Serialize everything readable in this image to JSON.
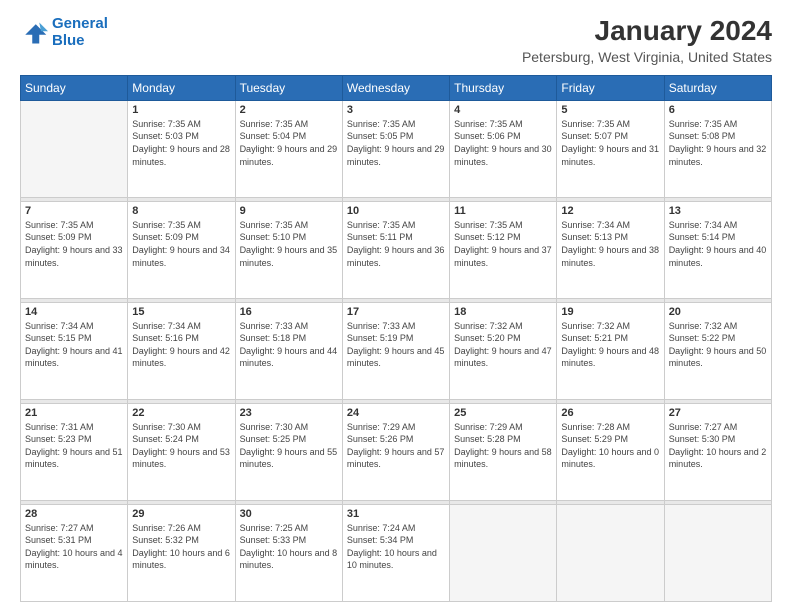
{
  "logo": {
    "line1": "General",
    "line2": "Blue"
  },
  "title": "January 2024",
  "subtitle": "Petersburg, West Virginia, United States",
  "weekdays": [
    "Sunday",
    "Monday",
    "Tuesday",
    "Wednesday",
    "Thursday",
    "Friday",
    "Saturday"
  ],
  "weeks": [
    [
      {
        "day": "",
        "sunrise": "",
        "sunset": "",
        "daylight": ""
      },
      {
        "day": "1",
        "sunrise": "Sunrise: 7:35 AM",
        "sunset": "Sunset: 5:03 PM",
        "daylight": "Daylight: 9 hours and 28 minutes."
      },
      {
        "day": "2",
        "sunrise": "Sunrise: 7:35 AM",
        "sunset": "Sunset: 5:04 PM",
        "daylight": "Daylight: 9 hours and 29 minutes."
      },
      {
        "day": "3",
        "sunrise": "Sunrise: 7:35 AM",
        "sunset": "Sunset: 5:05 PM",
        "daylight": "Daylight: 9 hours and 29 minutes."
      },
      {
        "day": "4",
        "sunrise": "Sunrise: 7:35 AM",
        "sunset": "Sunset: 5:06 PM",
        "daylight": "Daylight: 9 hours and 30 minutes."
      },
      {
        "day": "5",
        "sunrise": "Sunrise: 7:35 AM",
        "sunset": "Sunset: 5:07 PM",
        "daylight": "Daylight: 9 hours and 31 minutes."
      },
      {
        "day": "6",
        "sunrise": "Sunrise: 7:35 AM",
        "sunset": "Sunset: 5:08 PM",
        "daylight": "Daylight: 9 hours and 32 minutes."
      }
    ],
    [
      {
        "day": "7",
        "sunrise": "Sunrise: 7:35 AM",
        "sunset": "Sunset: 5:09 PM",
        "daylight": "Daylight: 9 hours and 33 minutes."
      },
      {
        "day": "8",
        "sunrise": "Sunrise: 7:35 AM",
        "sunset": "Sunset: 5:09 PM",
        "daylight": "Daylight: 9 hours and 34 minutes."
      },
      {
        "day": "9",
        "sunrise": "Sunrise: 7:35 AM",
        "sunset": "Sunset: 5:10 PM",
        "daylight": "Daylight: 9 hours and 35 minutes."
      },
      {
        "day": "10",
        "sunrise": "Sunrise: 7:35 AM",
        "sunset": "Sunset: 5:11 PM",
        "daylight": "Daylight: 9 hours and 36 minutes."
      },
      {
        "day": "11",
        "sunrise": "Sunrise: 7:35 AM",
        "sunset": "Sunset: 5:12 PM",
        "daylight": "Daylight: 9 hours and 37 minutes."
      },
      {
        "day": "12",
        "sunrise": "Sunrise: 7:34 AM",
        "sunset": "Sunset: 5:13 PM",
        "daylight": "Daylight: 9 hours and 38 minutes."
      },
      {
        "day": "13",
        "sunrise": "Sunrise: 7:34 AM",
        "sunset": "Sunset: 5:14 PM",
        "daylight": "Daylight: 9 hours and 40 minutes."
      }
    ],
    [
      {
        "day": "14",
        "sunrise": "Sunrise: 7:34 AM",
        "sunset": "Sunset: 5:15 PM",
        "daylight": "Daylight: 9 hours and 41 minutes."
      },
      {
        "day": "15",
        "sunrise": "Sunrise: 7:34 AM",
        "sunset": "Sunset: 5:16 PM",
        "daylight": "Daylight: 9 hours and 42 minutes."
      },
      {
        "day": "16",
        "sunrise": "Sunrise: 7:33 AM",
        "sunset": "Sunset: 5:18 PM",
        "daylight": "Daylight: 9 hours and 44 minutes."
      },
      {
        "day": "17",
        "sunrise": "Sunrise: 7:33 AM",
        "sunset": "Sunset: 5:19 PM",
        "daylight": "Daylight: 9 hours and 45 minutes."
      },
      {
        "day": "18",
        "sunrise": "Sunrise: 7:32 AM",
        "sunset": "Sunset: 5:20 PM",
        "daylight": "Daylight: 9 hours and 47 minutes."
      },
      {
        "day": "19",
        "sunrise": "Sunrise: 7:32 AM",
        "sunset": "Sunset: 5:21 PM",
        "daylight": "Daylight: 9 hours and 48 minutes."
      },
      {
        "day": "20",
        "sunrise": "Sunrise: 7:32 AM",
        "sunset": "Sunset: 5:22 PM",
        "daylight": "Daylight: 9 hours and 50 minutes."
      }
    ],
    [
      {
        "day": "21",
        "sunrise": "Sunrise: 7:31 AM",
        "sunset": "Sunset: 5:23 PM",
        "daylight": "Daylight: 9 hours and 51 minutes."
      },
      {
        "day": "22",
        "sunrise": "Sunrise: 7:30 AM",
        "sunset": "Sunset: 5:24 PM",
        "daylight": "Daylight: 9 hours and 53 minutes."
      },
      {
        "day": "23",
        "sunrise": "Sunrise: 7:30 AM",
        "sunset": "Sunset: 5:25 PM",
        "daylight": "Daylight: 9 hours and 55 minutes."
      },
      {
        "day": "24",
        "sunrise": "Sunrise: 7:29 AM",
        "sunset": "Sunset: 5:26 PM",
        "daylight": "Daylight: 9 hours and 57 minutes."
      },
      {
        "day": "25",
        "sunrise": "Sunrise: 7:29 AM",
        "sunset": "Sunset: 5:28 PM",
        "daylight": "Daylight: 9 hours and 58 minutes."
      },
      {
        "day": "26",
        "sunrise": "Sunrise: 7:28 AM",
        "sunset": "Sunset: 5:29 PM",
        "daylight": "Daylight: 10 hours and 0 minutes."
      },
      {
        "day": "27",
        "sunrise": "Sunrise: 7:27 AM",
        "sunset": "Sunset: 5:30 PM",
        "daylight": "Daylight: 10 hours and 2 minutes."
      }
    ],
    [
      {
        "day": "28",
        "sunrise": "Sunrise: 7:27 AM",
        "sunset": "Sunset: 5:31 PM",
        "daylight": "Daylight: 10 hours and 4 minutes."
      },
      {
        "day": "29",
        "sunrise": "Sunrise: 7:26 AM",
        "sunset": "Sunset: 5:32 PM",
        "daylight": "Daylight: 10 hours and 6 minutes."
      },
      {
        "day": "30",
        "sunrise": "Sunrise: 7:25 AM",
        "sunset": "Sunset: 5:33 PM",
        "daylight": "Daylight: 10 hours and 8 minutes."
      },
      {
        "day": "31",
        "sunrise": "Sunrise: 7:24 AM",
        "sunset": "Sunset: 5:34 PM",
        "daylight": "Daylight: 10 hours and 10 minutes."
      },
      {
        "day": "",
        "sunrise": "",
        "sunset": "",
        "daylight": ""
      },
      {
        "day": "",
        "sunrise": "",
        "sunset": "",
        "daylight": ""
      },
      {
        "day": "",
        "sunrise": "",
        "sunset": "",
        "daylight": ""
      }
    ]
  ]
}
